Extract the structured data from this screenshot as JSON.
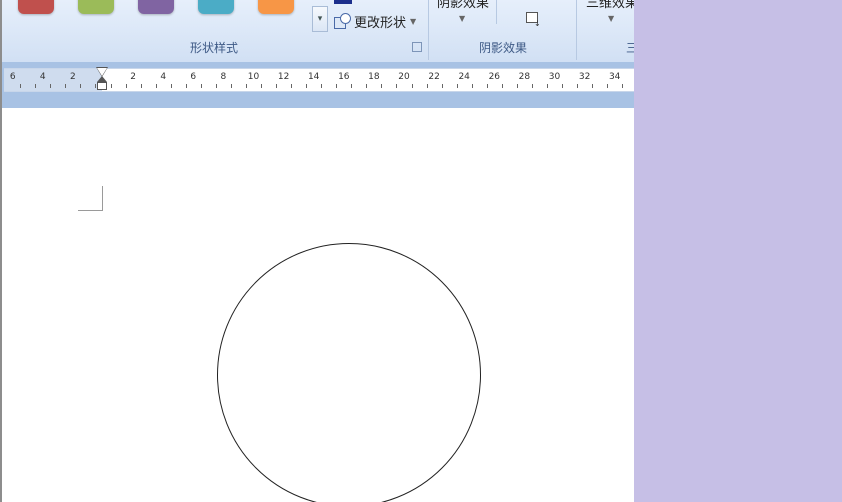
{
  "ribbon": {
    "shape_styles": {
      "group_label": "形状样式",
      "swatch_colors": [
        "#c0504d",
        "#9bbb59",
        "#8064a2",
        "#4bacc6",
        "#f79646"
      ],
      "change_shape_label": "更改形状"
    },
    "shadow_effects": {
      "group_label": "阴影效果",
      "button_label": "阴影效果"
    },
    "three_d": {
      "button_label": "三维效果",
      "group_label_partial": "三"
    }
  },
  "ruler": {
    "left_labels": [
      "6",
      "4",
      "2"
    ],
    "right_labels": [
      "2",
      "4",
      "6",
      "8",
      "10",
      "12",
      "14",
      "16",
      "18",
      "20",
      "22",
      "24",
      "26",
      "28",
      "30",
      "32",
      "34"
    ]
  },
  "document": {
    "shape": "circle"
  },
  "colors": {
    "side_panel": "#c6bfe6",
    "ribbon_label": "#3e5a86",
    "ruler_band": "#a8c2e4"
  }
}
